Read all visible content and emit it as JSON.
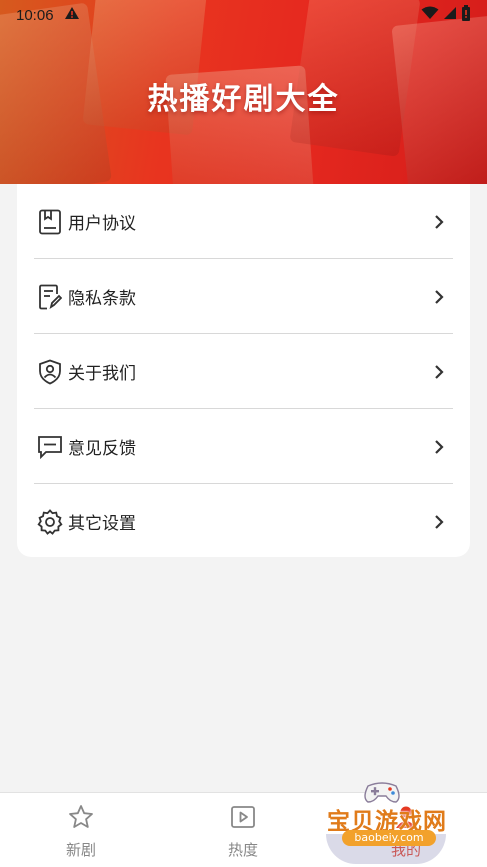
{
  "status_bar": {
    "time": "10:06"
  },
  "banner": {
    "title": "热播好剧大全"
  },
  "menu": {
    "items": [
      {
        "label": "用户协议",
        "icon": "document-bookmark-icon"
      },
      {
        "label": "隐私条款",
        "icon": "edit-document-icon"
      },
      {
        "label": "关于我们",
        "icon": "shield-user-icon"
      },
      {
        "label": "意见反馈",
        "icon": "message-icon"
      },
      {
        "label": "其它设置",
        "icon": "gear-icon"
      }
    ]
  },
  "tabbar": {
    "tabs": [
      {
        "label": "新剧",
        "icon": "star-icon"
      },
      {
        "label": "热度",
        "icon": "play-square-icon"
      },
      {
        "label": "我的",
        "icon": "user-icon"
      }
    ],
    "active_index": 2
  },
  "watermark": {
    "text": "宝贝游戏网",
    "url": "baobeiy.com"
  },
  "colors": {
    "accent": "#e53922",
    "banner_start": "#d65a1e",
    "banner_end": "#d41c1a",
    "background": "#f3f3f3"
  }
}
